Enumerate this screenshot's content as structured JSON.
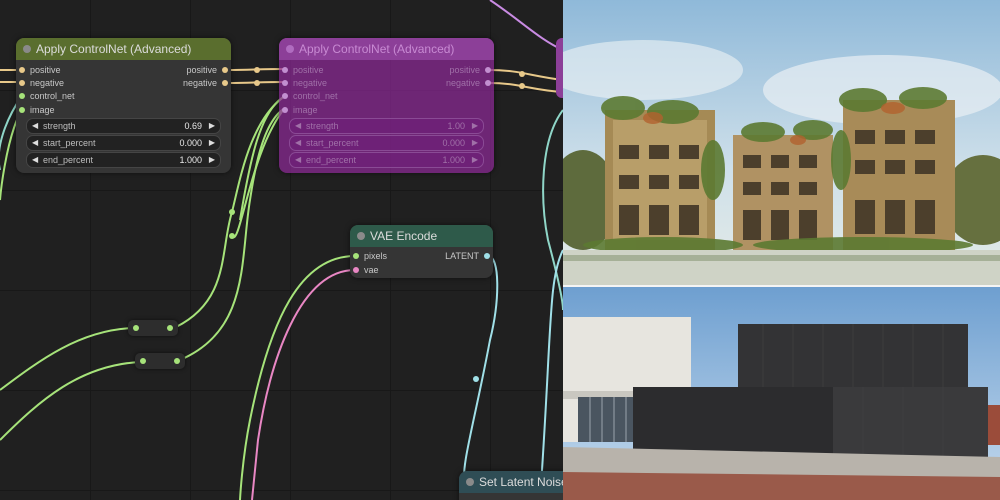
{
  "canvas": {
    "node_apply1": {
      "title": "Apply ControlNet (Advanced)",
      "inputs": [
        "positive",
        "negative",
        "control_net",
        "image"
      ],
      "outputs": [
        "positive",
        "negative"
      ],
      "widgets": [
        {
          "label": "strength",
          "value": "0.69"
        },
        {
          "label": "start_percent",
          "value": "0.000"
        },
        {
          "label": "end_percent",
          "value": "1.000"
        }
      ]
    },
    "node_apply2": {
      "title": "Apply ControlNet (Advanced)",
      "inputs": [
        "positive",
        "negative",
        "control_net",
        "image"
      ],
      "outputs": [
        "positive",
        "negative"
      ],
      "widgets": [
        {
          "label": "strength",
          "value": "1.00"
        },
        {
          "label": "start_percent",
          "value": "0.000"
        },
        {
          "label": "end_percent",
          "value": "1.000"
        }
      ]
    },
    "node_vae": {
      "title": "VAE Encode",
      "inputs": [
        "pixels",
        "vae"
      ],
      "outputs": [
        "LATENT"
      ]
    },
    "node_latent": {
      "title": "Set Latent Noise Ma"
    },
    "colors": {
      "canvas_bg": "#202020",
      "node_bg": "#353535",
      "green_title": "#5a6e2e",
      "teal_title": "#2e5a4a",
      "bypass_purple": "#8c3f98",
      "wire_conditioning": "#e8c98a",
      "wire_image": "#a6e37a",
      "wire_vae": "#e987c4",
      "wire_latent": "#a0e0e8",
      "wire_controlnet": "#8fd6c8"
    }
  },
  "right_panel": {
    "top_image": "sketch-style overgrown apartment buildings",
    "bottom_image": "black box-shaped building on brick plaza"
  }
}
